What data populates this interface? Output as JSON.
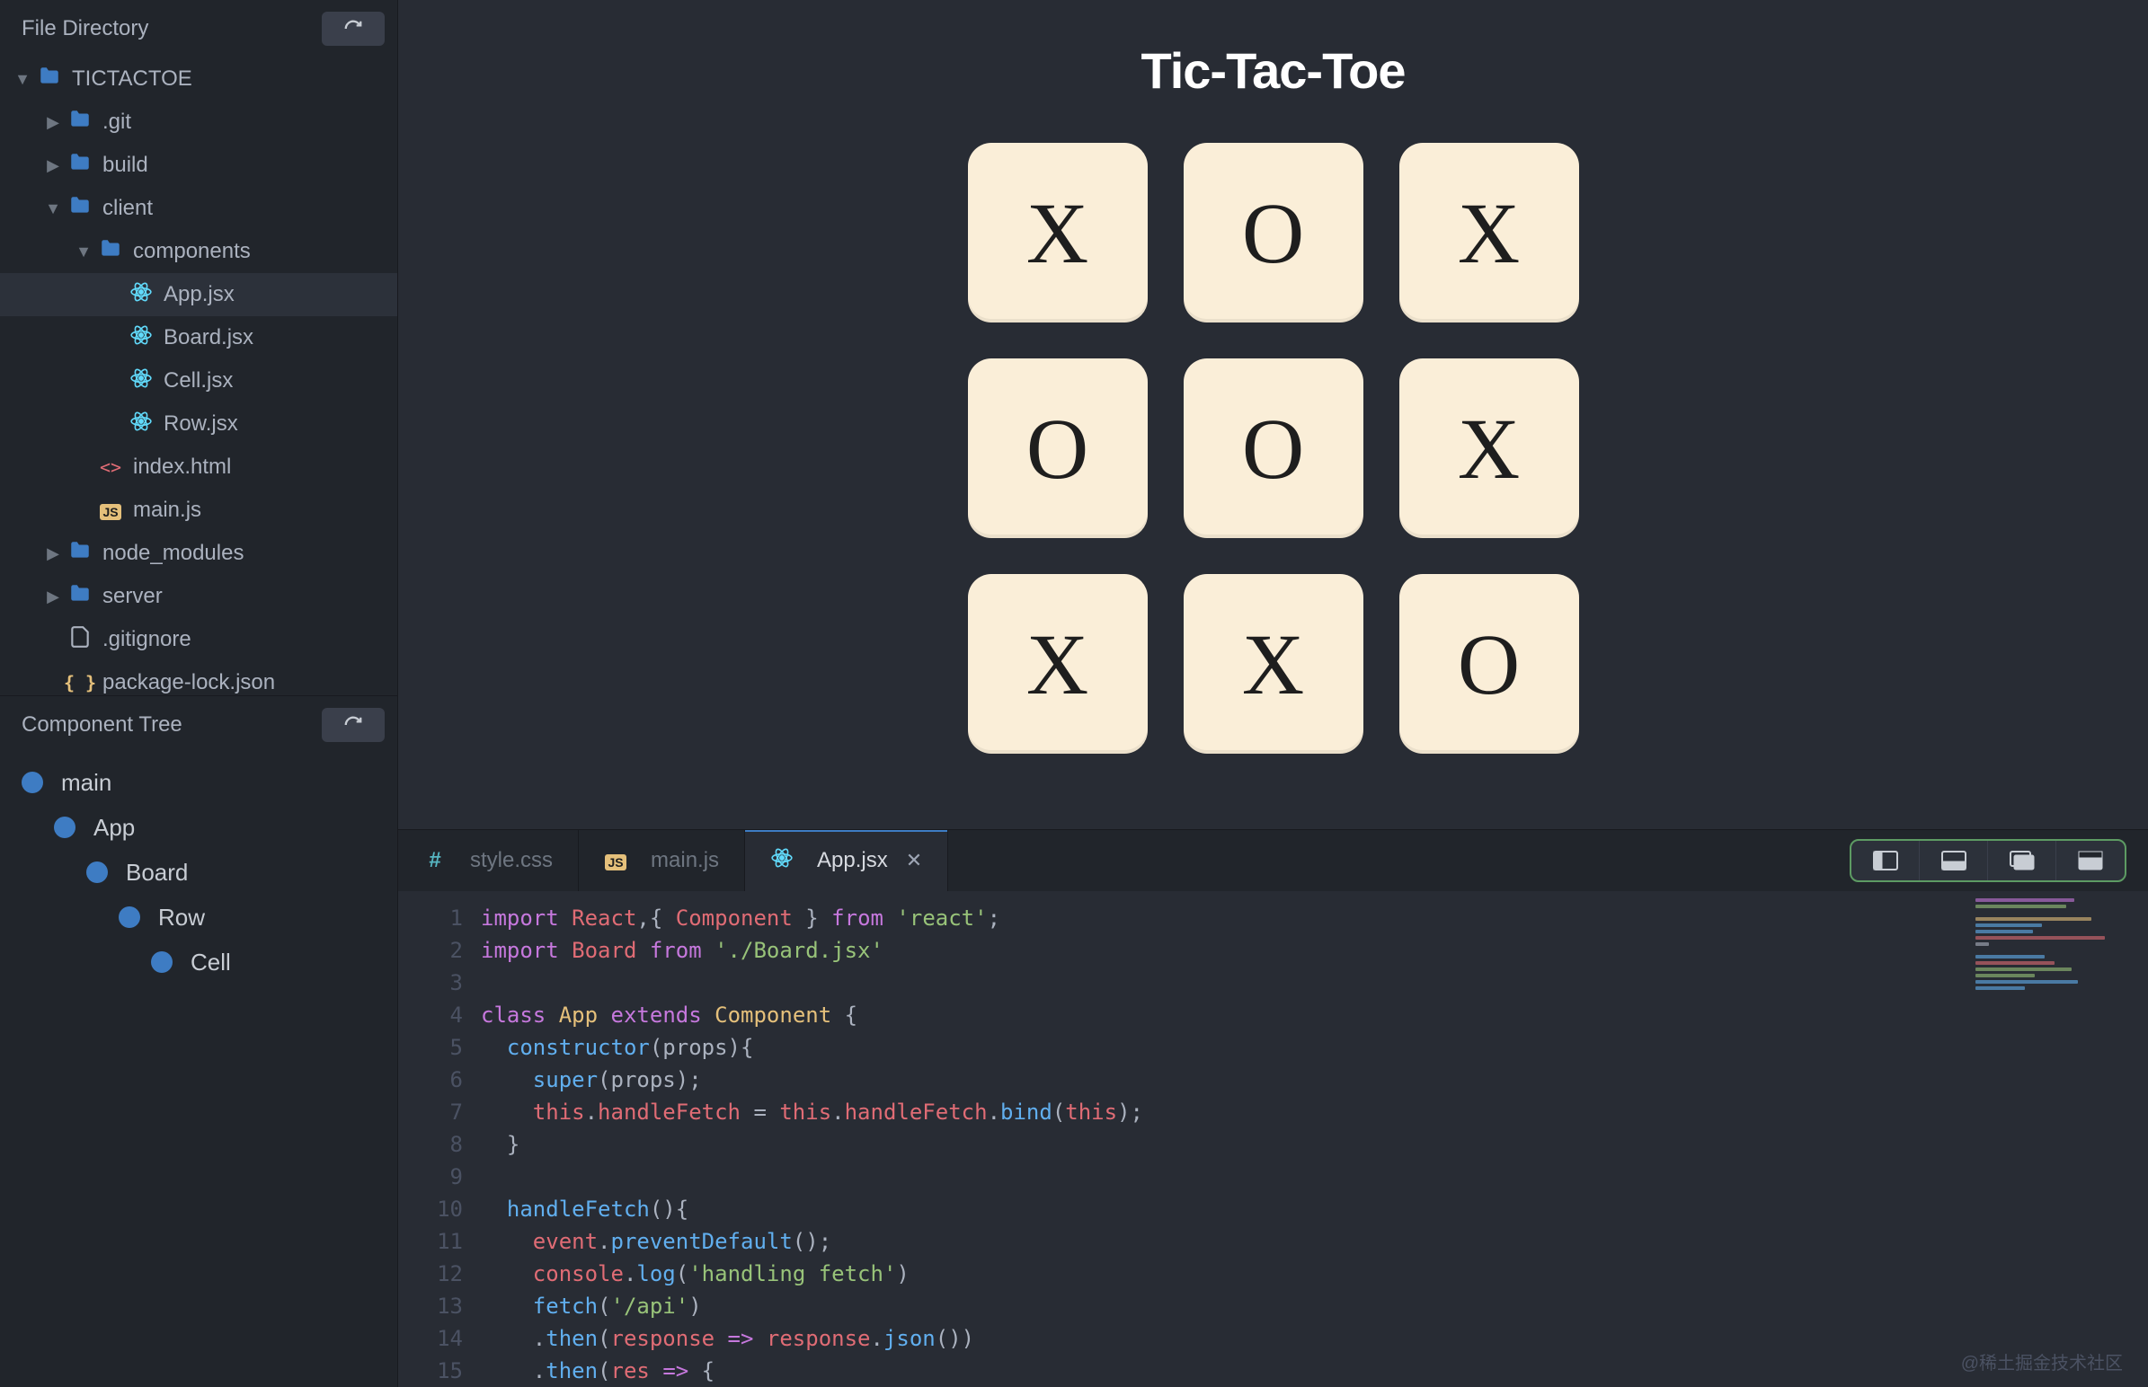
{
  "sidebar": {
    "file_directory_title": "File Directory",
    "component_tree_title": "Component Tree",
    "tree": [
      {
        "depth": 0,
        "chevron": "down",
        "icon": "folder",
        "label": "TICTACTOE",
        "selected": false
      },
      {
        "depth": 1,
        "chevron": "right",
        "icon": "folder",
        "label": ".git",
        "selected": false
      },
      {
        "depth": 1,
        "chevron": "right",
        "icon": "folder",
        "label": "build",
        "selected": false
      },
      {
        "depth": 1,
        "chevron": "down",
        "icon": "folder",
        "label": "client",
        "selected": false
      },
      {
        "depth": 2,
        "chevron": "down",
        "icon": "folder",
        "label": "components",
        "selected": false
      },
      {
        "depth": 3,
        "chevron": "",
        "icon": "react",
        "label": "App.jsx",
        "selected": true
      },
      {
        "depth": 3,
        "chevron": "",
        "icon": "react",
        "label": "Board.jsx",
        "selected": false
      },
      {
        "depth": 3,
        "chevron": "",
        "icon": "react",
        "label": "Cell.jsx",
        "selected": false
      },
      {
        "depth": 3,
        "chevron": "",
        "icon": "react",
        "label": "Row.jsx",
        "selected": false
      },
      {
        "depth": 2,
        "chevron": "",
        "icon": "html",
        "label": "index.html",
        "selected": false
      },
      {
        "depth": 2,
        "chevron": "",
        "icon": "js",
        "label": "main.js",
        "selected": false
      },
      {
        "depth": 1,
        "chevron": "right",
        "icon": "folder",
        "label": "node_modules",
        "selected": false
      },
      {
        "depth": 1,
        "chevron": "right",
        "icon": "folder",
        "label": "server",
        "selected": false
      },
      {
        "depth": 1,
        "chevron": "",
        "icon": "file",
        "label": ".gitignore",
        "selected": false
      },
      {
        "depth": 1,
        "chevron": "",
        "icon": "json",
        "label": "package-lock.json",
        "selected": false
      }
    ],
    "components": [
      {
        "depth": 0,
        "label": "main"
      },
      {
        "depth": 1,
        "label": "App"
      },
      {
        "depth": 2,
        "label": "Board"
      },
      {
        "depth": 3,
        "label": "Row"
      },
      {
        "depth": 4,
        "label": "Cell"
      }
    ]
  },
  "preview": {
    "title": "Tic-Tac-Toe",
    "cells": [
      "X",
      "O",
      "X",
      "O",
      "O",
      "X",
      "X",
      "X",
      "O"
    ]
  },
  "editor": {
    "tabs": [
      {
        "icon": "hash",
        "label": "style.css",
        "active": false,
        "close": false
      },
      {
        "icon": "js",
        "label": "main.js",
        "active": false,
        "close": false
      },
      {
        "icon": "react",
        "label": "App.jsx",
        "active": true,
        "close": true
      }
    ],
    "line_numbers": [
      "1",
      "2",
      "3",
      "4",
      "5",
      "6",
      "7",
      "8",
      "9",
      "10",
      "11",
      "12",
      "13",
      "14",
      "15"
    ],
    "code_lines": [
      [
        [
          "kw",
          "import"
        ],
        [
          "",
          " "
        ],
        [
          "var",
          "React"
        ],
        [
          "punc",
          ",{ "
        ],
        [
          "var",
          "Component"
        ],
        [
          "punc",
          " } "
        ],
        [
          "kw",
          "from"
        ],
        [
          "",
          " "
        ],
        [
          "str",
          "'react'"
        ],
        [
          "punc",
          ";"
        ]
      ],
      [
        [
          "kw",
          "import"
        ],
        [
          "",
          " "
        ],
        [
          "var",
          "Board"
        ],
        [
          "",
          " "
        ],
        [
          "kw",
          "from"
        ],
        [
          "",
          " "
        ],
        [
          "str",
          "'./Board.jsx'"
        ]
      ],
      [],
      [
        [
          "kw",
          "class"
        ],
        [
          "",
          " "
        ],
        [
          "cls",
          "App"
        ],
        [
          "",
          " "
        ],
        [
          "kw",
          "extends"
        ],
        [
          "",
          " "
        ],
        [
          "cls",
          "Component"
        ],
        [
          "",
          " "
        ],
        [
          "punc",
          "{"
        ]
      ],
      [
        [
          "",
          "  "
        ],
        [
          "fn",
          "constructor"
        ],
        [
          "punc",
          "(props){"
        ]
      ],
      [
        [
          "",
          "    "
        ],
        [
          "fn",
          "super"
        ],
        [
          "punc",
          "(props);"
        ]
      ],
      [
        [
          "",
          "    "
        ],
        [
          "this",
          "this"
        ],
        [
          "punc",
          "."
        ],
        [
          "prop",
          "handleFetch"
        ],
        [
          "",
          " = "
        ],
        [
          "this",
          "this"
        ],
        [
          "punc",
          "."
        ],
        [
          "prop",
          "handleFetch"
        ],
        [
          "punc",
          "."
        ],
        [
          "fn",
          "bind"
        ],
        [
          "punc",
          "("
        ],
        [
          "this",
          "this"
        ],
        [
          "punc",
          ");"
        ]
      ],
      [
        [
          "",
          "  "
        ],
        [
          "punc",
          "}"
        ]
      ],
      [],
      [
        [
          "",
          "  "
        ],
        [
          "fn",
          "handleFetch"
        ],
        [
          "punc",
          "(){"
        ]
      ],
      [
        [
          "",
          "    "
        ],
        [
          "var",
          "event"
        ],
        [
          "punc",
          "."
        ],
        [
          "fn",
          "preventDefault"
        ],
        [
          "punc",
          "();"
        ]
      ],
      [
        [
          "",
          "    "
        ],
        [
          "var",
          "console"
        ],
        [
          "punc",
          "."
        ],
        [
          "fn",
          "log"
        ],
        [
          "punc",
          "("
        ],
        [
          "str",
          "'handling fetch'"
        ],
        [
          "punc",
          ")"
        ]
      ],
      [
        [
          "",
          "    "
        ],
        [
          "fn",
          "fetch"
        ],
        [
          "punc",
          "("
        ],
        [
          "str",
          "'/api'"
        ],
        [
          "punc",
          ")"
        ]
      ],
      [
        [
          "",
          "    "
        ],
        [
          "punc",
          "."
        ],
        [
          "fn",
          "then"
        ],
        [
          "punc",
          "("
        ],
        [
          "var",
          "response"
        ],
        [
          "",
          " "
        ],
        [
          "kw",
          "=>"
        ],
        [
          "",
          " "
        ],
        [
          "var",
          "response"
        ],
        [
          "punc",
          "."
        ],
        [
          "fn",
          "json"
        ],
        [
          "punc",
          "())"
        ]
      ],
      [
        [
          "",
          "    "
        ],
        [
          "punc",
          "."
        ],
        [
          "fn",
          "then"
        ],
        [
          "punc",
          "("
        ],
        [
          "var",
          "res"
        ],
        [
          "",
          " "
        ],
        [
          "kw",
          "=>"
        ],
        [
          "",
          " "
        ],
        [
          "punc",
          "{"
        ]
      ]
    ],
    "minimap_lines": [
      {
        "w": 60,
        "c": "#c678dd"
      },
      {
        "w": 55,
        "c": "#98c379"
      },
      {
        "w": 0,
        "c": ""
      },
      {
        "w": 70,
        "c": "#e5c07b"
      },
      {
        "w": 40,
        "c": "#61afef"
      },
      {
        "w": 35,
        "c": "#61afef"
      },
      {
        "w": 78,
        "c": "#e06c75"
      },
      {
        "w": 8,
        "c": "#abb2bf"
      },
      {
        "w": 0,
        "c": ""
      },
      {
        "w": 42,
        "c": "#61afef"
      },
      {
        "w": 48,
        "c": "#e06c75"
      },
      {
        "w": 58,
        "c": "#98c379"
      },
      {
        "w": 36,
        "c": "#98c379"
      },
      {
        "w": 62,
        "c": "#61afef"
      },
      {
        "w": 30,
        "c": "#61afef"
      }
    ]
  },
  "watermark": "@稀土掘金技术社区"
}
